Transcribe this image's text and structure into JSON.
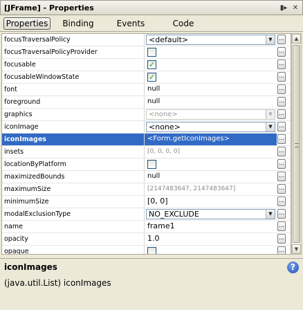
{
  "window": {
    "title": "[JFrame] - Properties",
    "icons": [
      "dock-icon",
      "close-icon"
    ]
  },
  "tabs": [
    {
      "label": "Properties",
      "active": true
    },
    {
      "label": "Binding",
      "active": false
    },
    {
      "label": "Events",
      "active": false
    },
    {
      "label": "Code",
      "active": false
    }
  ],
  "properties": [
    {
      "name": "focusTraversalPolicy",
      "kind": "combo",
      "value": "<default>"
    },
    {
      "name": "focusTraversalPolicyProvider",
      "kind": "check",
      "checked": false
    },
    {
      "name": "focusable",
      "kind": "check",
      "checked": true
    },
    {
      "name": "focusableWindowState",
      "kind": "check",
      "checked": true
    },
    {
      "name": "font",
      "kind": "text",
      "value": "null"
    },
    {
      "name": "foreground",
      "kind": "text",
      "value": "null"
    },
    {
      "name": "graphics",
      "kind": "combo-disabled",
      "value": "<none>"
    },
    {
      "name": "iconImage",
      "kind": "combo",
      "value": "<none>"
    },
    {
      "name": "iconImages",
      "kind": "text",
      "value": "<Form.getIconImages>",
      "selected": true
    },
    {
      "name": "insets",
      "kind": "gray",
      "value": "[0, 0, 0, 0]"
    },
    {
      "name": "locationByPlatform",
      "kind": "check",
      "checked": false
    },
    {
      "name": "maximizedBounds",
      "kind": "text",
      "value": "null"
    },
    {
      "name": "maximumSize",
      "kind": "gray",
      "value": "[2147483647, 2147483647]"
    },
    {
      "name": "minimumSize",
      "kind": "big",
      "value": "[0, 0]"
    },
    {
      "name": "modalExclusionType",
      "kind": "combo",
      "value": "NO_EXCLUDE"
    },
    {
      "name": "name",
      "kind": "big",
      "value": "frame1"
    },
    {
      "name": "opacity",
      "kind": "big",
      "value": "1.0"
    },
    {
      "name": "opaque",
      "kind": "check",
      "checked": false
    }
  ],
  "button_label": "...",
  "description": {
    "title": "iconImages",
    "text": "(java.util.List) iconImages"
  }
}
